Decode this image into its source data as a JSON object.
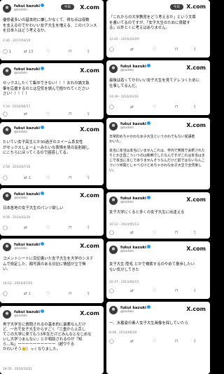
{
  "brand": "X.com",
  "today_badge": "今日",
  "user": {
    "name": "fukui kazuki",
    "handle": "@kaiteki"
  },
  "left": [
    {
      "body": "優修者多いの基本的に嫌しかなくて、得な点は母数\nを支えるのでかわいい女子大生を増える、このバランス\nを日本人はどう考えるか。",
      "meta": "2:46 · 2017/04/10",
      "replies": "1",
      "reposts": "13",
      "likes": "",
      "header": true
    },
    {
      "body": "セックスしたくて集中できない！！！おれの論文執\n筆を応援するのとは空気を読んで抱かれてください\nさい！！！！！",
      "meta": "7:34 · 2016/06/17",
      "replies": "",
      "reposts": "",
      "likes": "",
      "header": true
    },
    {
      "body": "たいてい女子高生とか30過ぎのスイーム系女性\nがセックスしよーよーみたいな表情を見の反射越し\nにこちらにほってくるので困惑してる。",
      "meta": "2:58 · 2010/07/16",
      "replies": "",
      "reposts": "1",
      "likes": "",
      "header": true
    },
    {
      "body": "日本各地の女子大生のパンツ欲しい",
      "meta": "9:58 · 2014/02/30",
      "replies": "",
      "reposts": "",
      "likes": "",
      "header": true
    },
    {
      "body": "コメントシートに目記書いた女子大生を大学のシステ\nムで特定した、顔写真のある日記に情値が立で無\nい。",
      "meta": "10:52 · 2016/07/20",
      "replies": "",
      "reposts": "1",
      "likes": "",
      "header": true
    },
    {
      "body": "男子大学生に質問されるの基本的に最悪なんだけ\nど、一方で女子大生からすごく「三重から上京し\nてこの大学に来てもう3年生だけどみんなとなじめな\nいし大学つまんない」とか相談されるのが「知\nら...ね」ーーーーーーーーーー（超ウケる\nかわいそう🥲）っくなりました。",
      "meta": "18:35 · 2016/10/21",
      "replies": "",
      "reposts": "",
      "likes": "",
      "header": true
    }
  ],
  "right": [
    {
      "body": "「これからの大学教育をどう考えるか」という文章\nを書いてるのですが、「女子大生のために貢献す\nる」以外とくに考えはありません。",
      "meta": "12:45 · 2016/10/29",
      "replies": "",
      "reposts": "",
      "likes": "",
      "header": false
    },
    {
      "body": "最後は若くてかわいい女子大生を見てデレつくために\n仕事してるんだ。",
      "meta": "14:29 · 2016/03/31",
      "replies": "",
      "reposts": "",
      "likes": "",
      "header": true
    },
    {
      "body": "日常的めちゃかわな女子大生というかわでもない受講者\nかいた。\n\n本当に本当は本当にいませんこれは、学内で笑顔で会釈されたりとか正直こういうのは新鮮でしたなんですがこれは本当はまじで本当にまじでありませんそうなんだけど前ではないなんこういう世間としゃべらけとめちゃかわな女子大生で全然楽しい。",
      "meta": "",
      "replies": "",
      "reposts": "",
      "likes": "",
      "header": true
    },
    {
      "body": "女子大学にくると多くの女子大生に出逢える",
      "meta": "10:12 · 2014/05/13",
      "replies": "",
      "reposts": "",
      "likes": "",
      "header": true
    },
    {
      "body": "女子大生 陸毛 とかで検索するのやめて散歩したい\nない気がしてきた",
      "meta": "20:37 · 2014/06/15",
      "replies": "",
      "reposts": "",
      "likes": "",
      "header": true
    },
    {
      "body": "ー、水着姿の素人女子大生画像を探していたら",
      "meta": "8:48 · 2014/06/30",
      "replies": "",
      "reposts": "",
      "likes": "",
      "header": true
    }
  ],
  "icons": [
    "reply-icon",
    "repost-icon",
    "like-icon",
    "bookmark-icon",
    "share-icon"
  ]
}
